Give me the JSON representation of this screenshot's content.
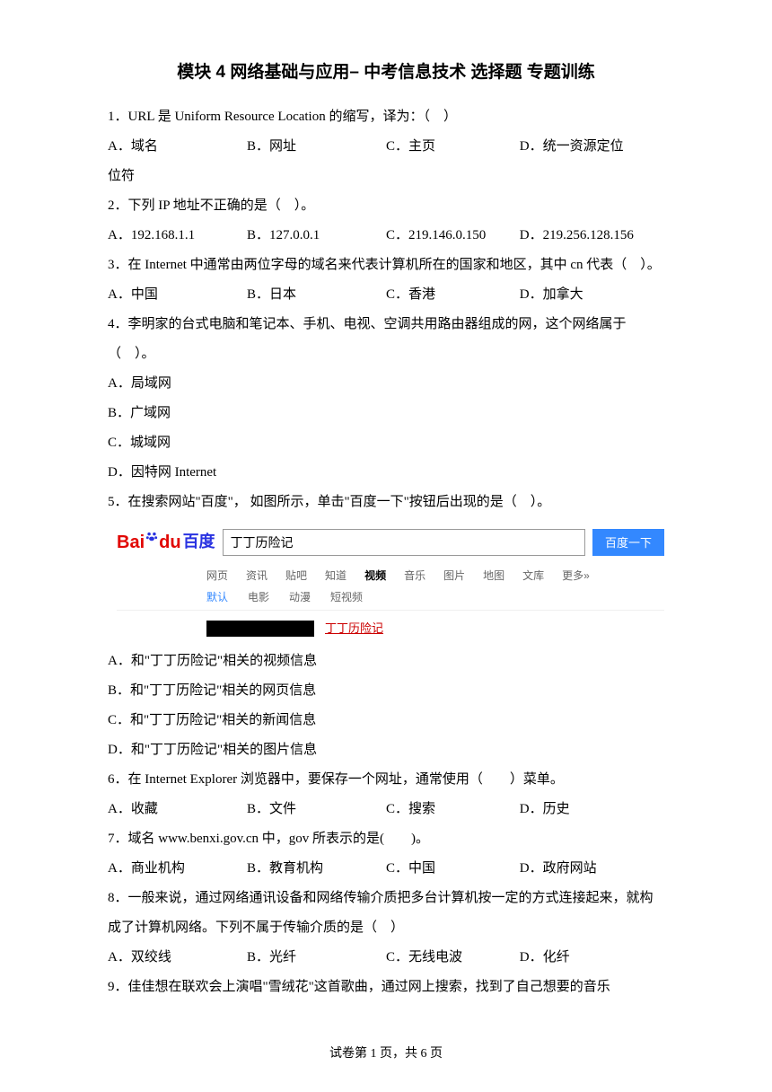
{
  "title": "模块 4 网络基础与应用– 中考信息技术 选择题 专题训练",
  "q1": {
    "stem": "1．URL 是 Uniform Resource Location 的缩写，译为：（　）",
    "a": "A．域名",
    "b": "B．网址",
    "c": "C．主页",
    "d": "D．统一资源定位",
    "cont": "位符"
  },
  "q2": {
    "stem": "2．下列 IP 地址不正确的是（　）。",
    "a": "A．192.168.1.1",
    "b": "B．127.0.0.1",
    "c": "C．219.146.0.150",
    "d": "D．219.256.128.156"
  },
  "q3": {
    "stem": "3．在 Internet 中通常由两位字母的域名来代表计算机所在的国家和地区，其中 cn 代表（　）。",
    "a": "A．中国",
    "b": "B．日本",
    "c": "C．香港",
    "d": "D．加拿大"
  },
  "q4": {
    "stem": "4．李明家的台式电脑和笔记本、手机、电视、空调共用路由器组成的网，这个网络属于（　）。",
    "a": "A．局域网",
    "b": "B．广域网",
    "c": "C．城域网",
    "d": "D．因特网 Internet"
  },
  "q5": {
    "stem": "5．在搜索网站\"百度\"， 如图所示，单击\"百度一下\"按钮后出现的是（　）。",
    "a": "A．和\"丁丁历险记\"相关的视频信息",
    "b": "B．和\"丁丁历险记\"相关的网页信息",
    "c": "C．和\"丁丁历险记\"相关的新闻信息",
    "d": "D．和\"丁丁历险记\"相关的图片信息"
  },
  "q6": {
    "stem": "6．在 Internet Explorer 浏览器中，要保存一个网址，通常使用（　　）菜单。",
    "a": "A．收藏",
    "b": "B．文件",
    "c": "C．搜索",
    "d": "D．历史"
  },
  "q7": {
    "stem": "7．域名 www.benxi.gov.cn 中，gov 所表示的是(　　)。",
    "a": "A．商业机构",
    "b": "B．教育机构",
    "c": "C．中国",
    "d": "D．政府网站"
  },
  "q8": {
    "stem": "8．一般来说，通过网络通讯设备和网络传输介质把多台计算机按一定的方式连接起来，就构成了计算机网络。下列不属于传输介质的是（　）",
    "a": "A．双绞线",
    "b": "B．光纤",
    "c": "C．无线电波",
    "d": "D．化纤"
  },
  "q9": {
    "stem": "9．佳佳想在联欢会上演唱\"雪绒花\"这首歌曲，通过网上搜索，找到了自己想要的音乐"
  },
  "baidu": {
    "logo": {
      "bai": "Bai",
      "du": "du",
      "cn": "百度"
    },
    "searchValue": "丁丁历险记",
    "btn": "百度一下",
    "tabs": [
      "网页",
      "资讯",
      "贴吧",
      "知道",
      "视频",
      "音乐",
      "图片",
      "地图",
      "文库",
      "更多»"
    ],
    "subtabs": [
      "默认",
      "电影",
      "动漫",
      "短视频"
    ],
    "resultTitle": "丁丁历险记"
  },
  "footer": "试卷第 1 页，共 6 页"
}
